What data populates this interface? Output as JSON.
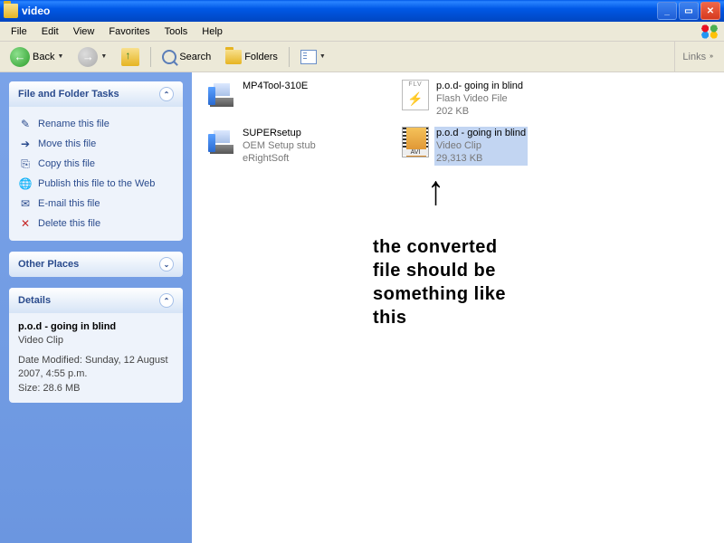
{
  "window": {
    "title": "video"
  },
  "menu": {
    "file": "File",
    "edit": "Edit",
    "view": "View",
    "favorites": "Favorites",
    "tools": "Tools",
    "help": "Help"
  },
  "toolbar": {
    "back": "Back",
    "search": "Search",
    "folders": "Folders",
    "links": "Links"
  },
  "sidebar": {
    "tasks_title": "File and Folder Tasks",
    "tasks": {
      "rename": "Rename this file",
      "move": "Move this file",
      "copy": "Copy this file",
      "publish": "Publish this file to the Web",
      "email": "E-mail this file",
      "delete": "Delete this file"
    },
    "other_title": "Other Places",
    "details_title": "Details",
    "details": {
      "name": "p.o.d - going in blind",
      "type": "Video Clip",
      "modified": "Date Modified: Sunday, 12 August 2007, 4:55 p.m.",
      "size": "Size: 28.6 MB"
    }
  },
  "files": {
    "mp4tool": {
      "name": "MP4Tool-310E"
    },
    "supersetup": {
      "name": "SUPERsetup",
      "line2": "OEM Setup stub",
      "line3": "eRightSoft"
    },
    "flv": {
      "name": "p.o.d- going in blind",
      "line2": "Flash Video File",
      "line3": "202 KB"
    },
    "avi": {
      "name": "p.o.d - going in blind",
      "line2": "Video Clip",
      "line3": "29,313 KB"
    }
  },
  "annotation": {
    "text": "the converted\nfile should be\nsomething like\nthis"
  }
}
